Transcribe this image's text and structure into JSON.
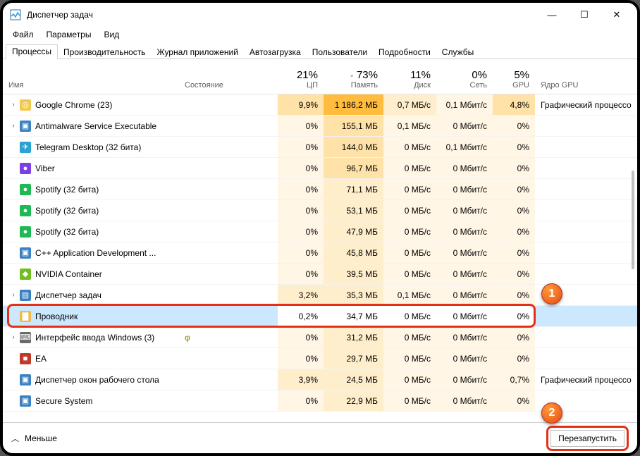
{
  "window": {
    "title": "Диспетчер задач"
  },
  "menu": {
    "file": "Файл",
    "options": "Параметры",
    "view": "Вид"
  },
  "tabs": {
    "processes": "Процессы",
    "performance": "Производительность",
    "app_history": "Журнал приложений",
    "startup": "Автозагрузка",
    "users": "Пользователи",
    "details": "Подробности",
    "services": "Службы"
  },
  "columns": {
    "name": "Имя",
    "state": "Состояние",
    "cpu": {
      "pct": "21%",
      "lbl": "ЦП"
    },
    "mem": {
      "pct": "73%",
      "lbl": "Память"
    },
    "disk": {
      "pct": "11%",
      "lbl": "Диск"
    },
    "net": {
      "pct": "0%",
      "lbl": "Сеть"
    },
    "gpu": {
      "pct": "5%",
      "lbl": "GPU"
    },
    "engine": "Ядро GPU"
  },
  "rows": [
    {
      "exp": true,
      "icon": "#f2c94c",
      "glyph": "◎",
      "name": "Google Chrome (23)",
      "cpu": "9,9%",
      "mem": "1 186,2 МБ",
      "disk": "0,7 МБ/с",
      "net": "0,1 Мбит/с",
      "gpu": "4,8%",
      "engine": "Графический процессо",
      "heat": {
        "cpu": 3,
        "mem": 5,
        "disk": 2,
        "net": 1,
        "gpu": 3
      }
    },
    {
      "exp": true,
      "icon": "#3b82c4",
      "glyph": "▣",
      "name": "Antimalware Service Executable",
      "cpu": "0%",
      "mem": "155,1 МБ",
      "disk": "0,1 МБ/с",
      "net": "0 Мбит/с",
      "gpu": "0%",
      "engine": "",
      "heat": {
        "cpu": 1,
        "mem": 3,
        "disk": 1,
        "net": 1,
        "gpu": 1
      }
    },
    {
      "exp": false,
      "icon": "#29a3d6",
      "glyph": "✈",
      "name": "Telegram Desktop (32 бита)",
      "cpu": "0%",
      "mem": "144,0 МБ",
      "disk": "0 МБ/с",
      "net": "0,1 Мбит/с",
      "gpu": "0%",
      "engine": "",
      "heat": {
        "cpu": 1,
        "mem": 3,
        "disk": 1,
        "net": 1,
        "gpu": 1
      }
    },
    {
      "exp": false,
      "icon": "#7b3fe4",
      "glyph": "●",
      "name": "Viber",
      "cpu": "0%",
      "mem": "96,7 МБ",
      "disk": "0 МБ/с",
      "net": "0 Мбит/с",
      "gpu": "0%",
      "engine": "",
      "heat": {
        "cpu": 1,
        "mem": 3,
        "disk": 1,
        "net": 1,
        "gpu": 1
      }
    },
    {
      "exp": false,
      "icon": "#1db954",
      "glyph": "●",
      "name": "Spotify (32 бита)",
      "cpu": "0%",
      "mem": "71,1 МБ",
      "disk": "0 МБ/с",
      "net": "0 Мбит/с",
      "gpu": "0%",
      "engine": "",
      "heat": {
        "cpu": 1,
        "mem": 2,
        "disk": 1,
        "net": 1,
        "gpu": 1
      }
    },
    {
      "exp": false,
      "icon": "#1db954",
      "glyph": "●",
      "name": "Spotify (32 бита)",
      "cpu": "0%",
      "mem": "53,1 МБ",
      "disk": "0 МБ/с",
      "net": "0 Мбит/с",
      "gpu": "0%",
      "engine": "",
      "heat": {
        "cpu": 1,
        "mem": 2,
        "disk": 1,
        "net": 1,
        "gpu": 1
      }
    },
    {
      "exp": false,
      "icon": "#1db954",
      "glyph": "●",
      "name": "Spotify (32 бита)",
      "cpu": "0%",
      "mem": "47,9 МБ",
      "disk": "0 МБ/с",
      "net": "0 Мбит/с",
      "gpu": "0%",
      "engine": "",
      "heat": {
        "cpu": 1,
        "mem": 2,
        "disk": 1,
        "net": 1,
        "gpu": 1
      }
    },
    {
      "exp": false,
      "icon": "#3b82c4",
      "glyph": "▣",
      "name": "C++ Application Development ...",
      "cpu": "0%",
      "mem": "45,8 МБ",
      "disk": "0 МБ/с",
      "net": "0 Мбит/с",
      "gpu": "0%",
      "engine": "",
      "heat": {
        "cpu": 1,
        "mem": 2,
        "disk": 1,
        "net": 1,
        "gpu": 1
      }
    },
    {
      "exp": false,
      "icon": "#6fbf21",
      "glyph": "◆",
      "name": "NVIDIA Container",
      "cpu": "0%",
      "mem": "39,5 МБ",
      "disk": "0 МБ/с",
      "net": "0 Мбит/с",
      "gpu": "0%",
      "engine": "",
      "heat": {
        "cpu": 1,
        "mem": 2,
        "disk": 1,
        "net": 1,
        "gpu": 1
      }
    },
    {
      "exp": true,
      "icon": "#3b82c4",
      "glyph": "▤",
      "name": "Диспетчер задач",
      "cpu": "3,2%",
      "mem": "35,3 МБ",
      "disk": "0,1 МБ/с",
      "net": "0 Мбит/с",
      "gpu": "0%",
      "engine": "",
      "heat": {
        "cpu": 2,
        "mem": 2,
        "disk": 1,
        "net": 1,
        "gpu": 1
      }
    },
    {
      "exp": false,
      "selected": true,
      "icon": "#f2b94c",
      "glyph": "▇",
      "name": "Проводник",
      "cpu": "0,2%",
      "mem": "34,7 МБ",
      "disk": "0 МБ/с",
      "net": "0 Мбит/с",
      "gpu": "0%",
      "engine": "",
      "heat": {
        "cpu": 0,
        "mem": 0,
        "disk": 0,
        "net": 0,
        "gpu": 0
      }
    },
    {
      "exp": true,
      "icon": "#6a6a6a",
      "glyph": "⌨",
      "name": "Интерфейс ввода Windows (3)",
      "state": "φ",
      "cpu": "0%",
      "mem": "31,2 МБ",
      "disk": "0 МБ/с",
      "net": "0 Мбит/с",
      "gpu": "0%",
      "engine": "",
      "heat": {
        "cpu": 1,
        "mem": 2,
        "disk": 1,
        "net": 1,
        "gpu": 1
      }
    },
    {
      "exp": false,
      "icon": "#c0392b",
      "glyph": "■",
      "name": "EA",
      "cpu": "0%",
      "mem": "29,7 МБ",
      "disk": "0 МБ/с",
      "net": "0 Мбит/с",
      "gpu": "0%",
      "engine": "",
      "heat": {
        "cpu": 1,
        "mem": 2,
        "disk": 1,
        "net": 1,
        "gpu": 1
      }
    },
    {
      "exp": false,
      "icon": "#3b82c4",
      "glyph": "▣",
      "name": "Диспетчер окон рабочего стола",
      "cpu": "3,9%",
      "mem": "24,5 МБ",
      "disk": "0 МБ/с",
      "net": "0 Мбит/с",
      "gpu": "0,7%",
      "engine": "Графический процессо",
      "heat": {
        "cpu": 2,
        "mem": 2,
        "disk": 1,
        "net": 1,
        "gpu": 1
      }
    },
    {
      "exp": false,
      "icon": "#3b82c4",
      "glyph": "▣",
      "name": "Secure System",
      "cpu": "0%",
      "mem": "22,9 МБ",
      "disk": "0 МБ/с",
      "net": "0 Мбит/с",
      "gpu": "0%",
      "engine": "",
      "heat": {
        "cpu": 1,
        "mem": 2,
        "disk": 1,
        "net": 1,
        "gpu": 1
      }
    }
  ],
  "bottom": {
    "less": "Меньше",
    "restart": "Перезапустить"
  },
  "callouts": {
    "one": "1",
    "two": "2"
  }
}
